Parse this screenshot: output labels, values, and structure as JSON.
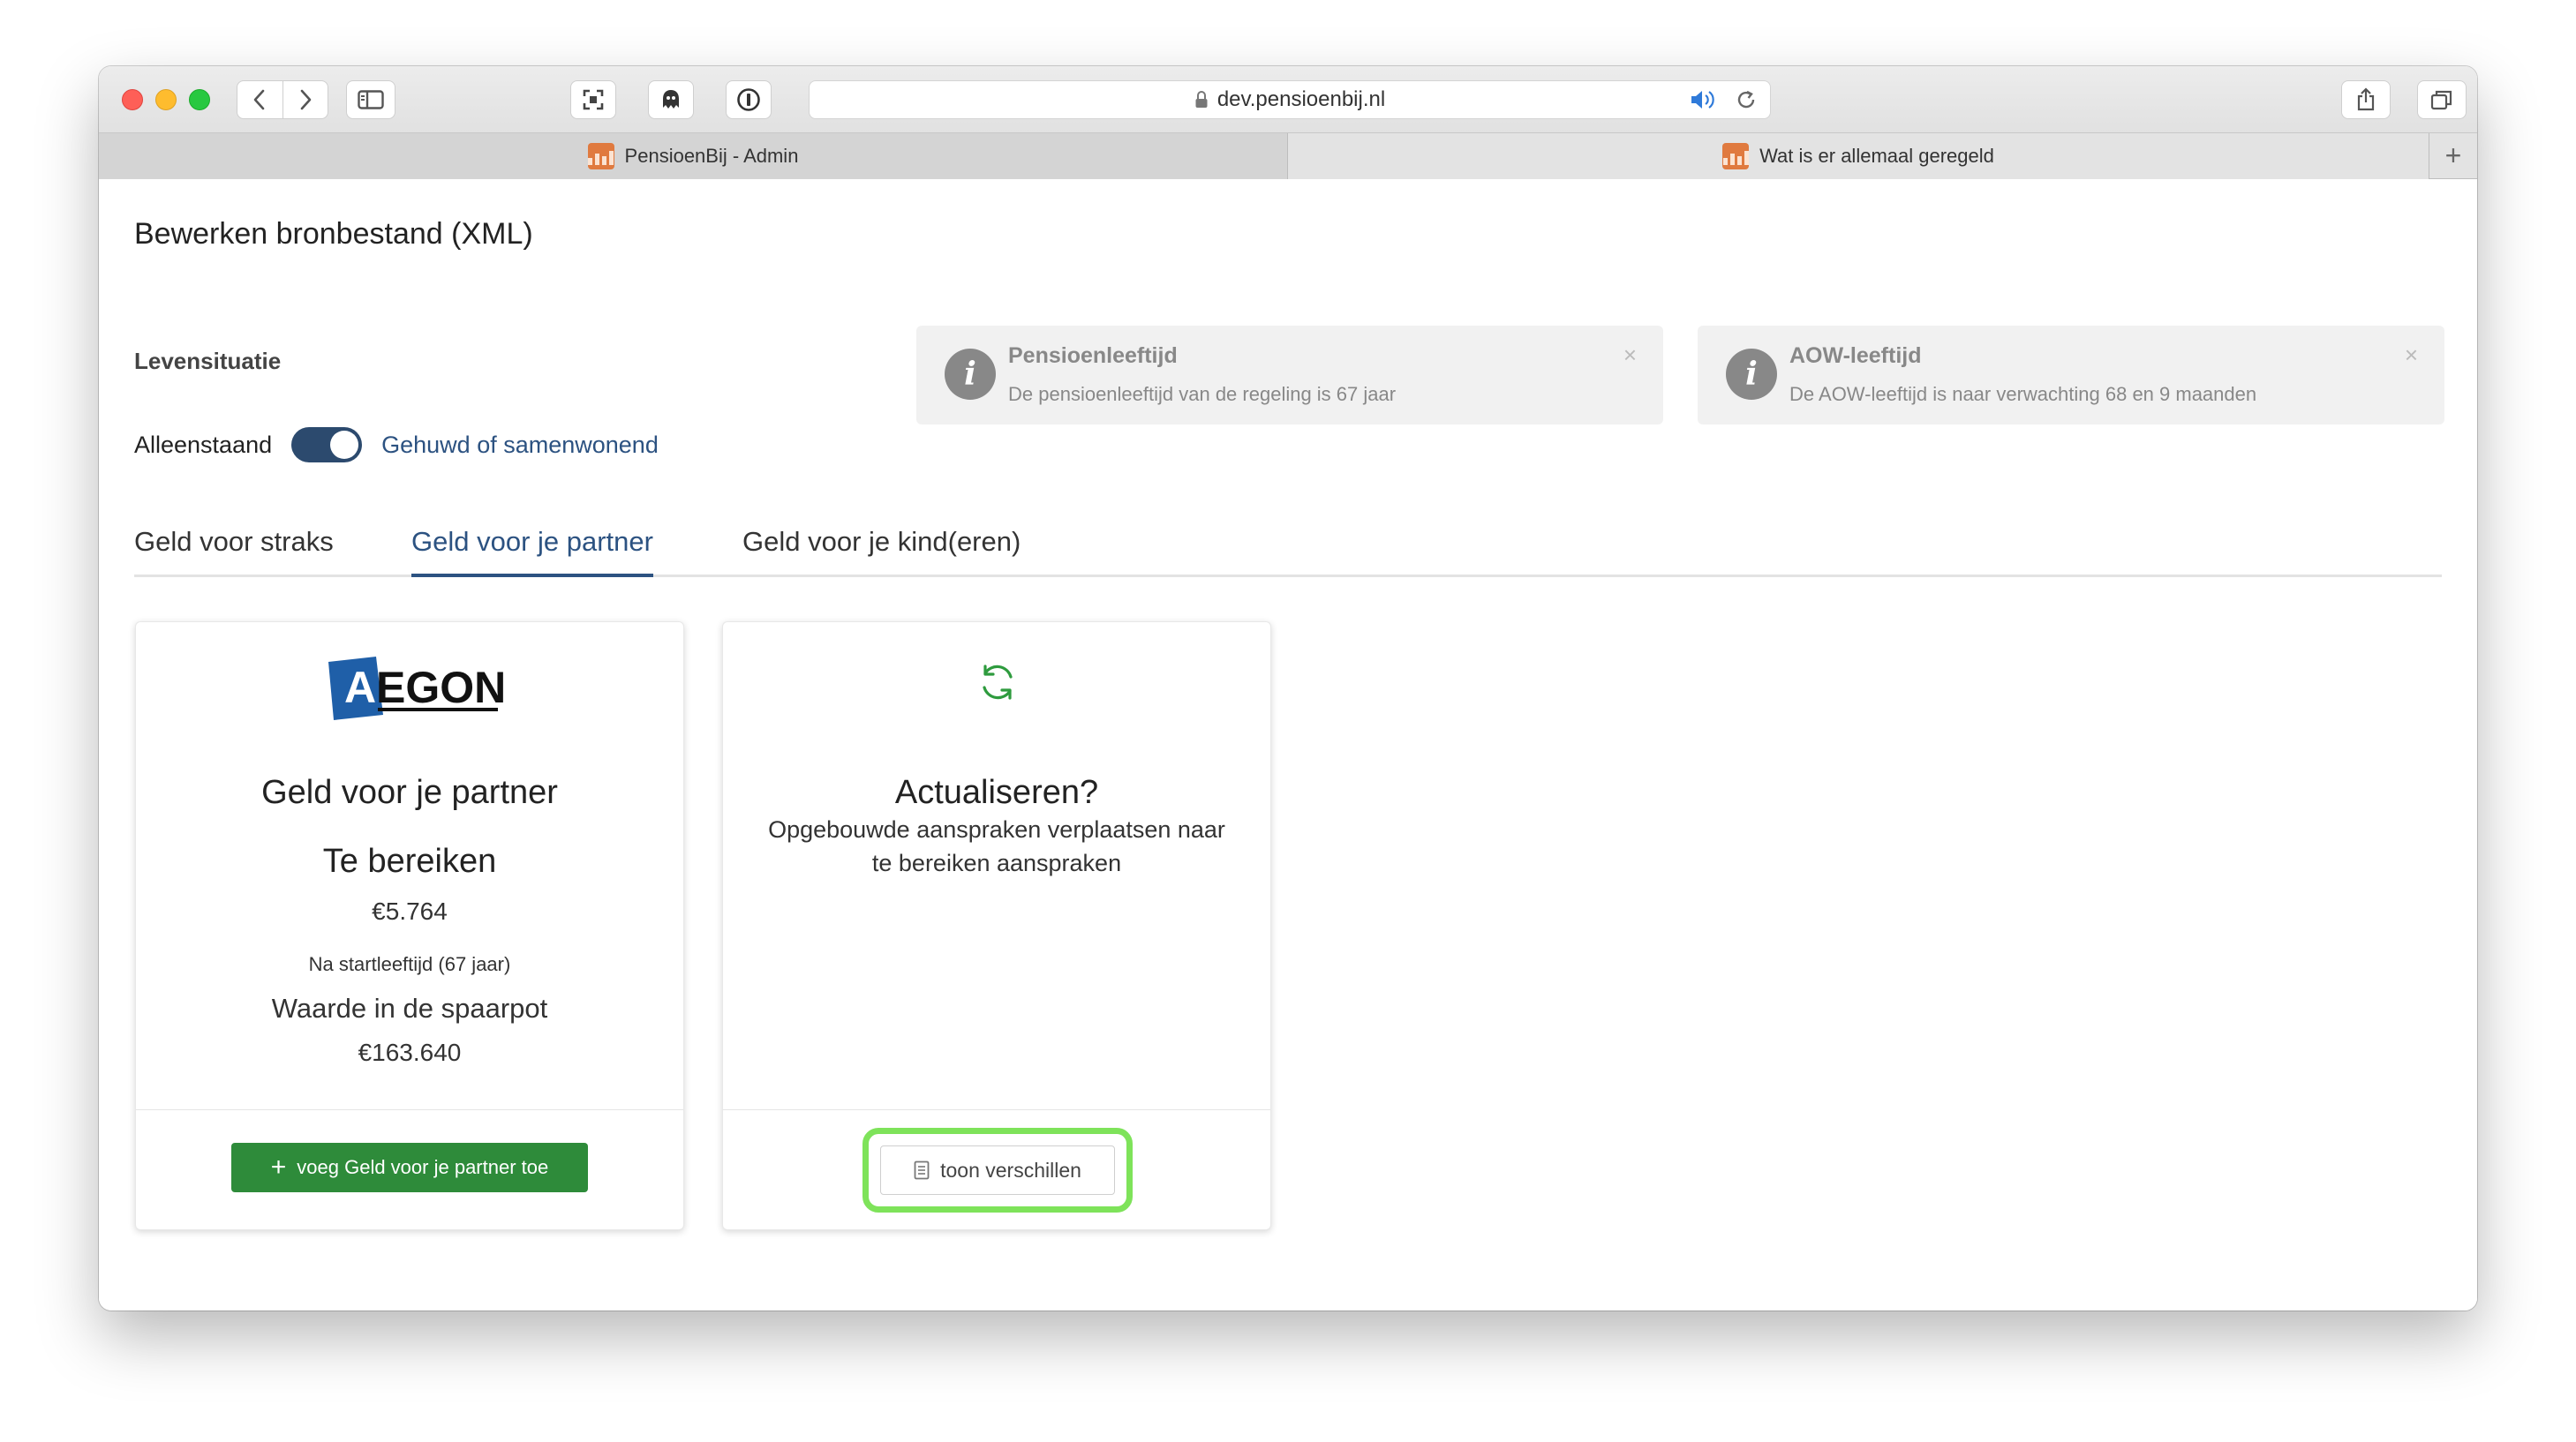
{
  "browser": {
    "url": "dev.pensioenbij.nl",
    "tabs": [
      {
        "label": "PensioenBij - Admin"
      },
      {
        "label": "Wat is er allemaal geregeld"
      }
    ],
    "new_tab": "+"
  },
  "page": {
    "title": "Bewerken bronbestand (XML)",
    "levensituatie": {
      "label": "Levensituatie",
      "option_off": "Alleenstaand",
      "option_on": "Gehuwd of samenwonend",
      "is_on": true
    },
    "alerts": [
      {
        "title": "Pensioenleeftijd",
        "text": "De pensioenleeftijd van de regeling is 67 jaar",
        "close": "×"
      },
      {
        "title": "AOW-leeftijd",
        "text": "De AOW-leeftijd is naar verwachting 68 en 9 maanden",
        "close": "×"
      }
    ],
    "tabs": [
      {
        "label": "Geld voor straks",
        "selected": false
      },
      {
        "label": "Geld voor je partner",
        "selected": true
      },
      {
        "label": "Geld voor je kind(eren)",
        "selected": false
      }
    ],
    "card_aegon": {
      "logo_text": "EGON",
      "logo_letter": "A",
      "heading": "Geld voor je partner",
      "target_label": "Te bereiken",
      "target_value": "€5.764",
      "start_note": "Na startleeftijd (67 jaar)",
      "savings_label": "Waarde in de spaarpot",
      "savings_value": "€163.640",
      "add_button": "voeg Geld voor je partner toe",
      "add_icon": "+"
    },
    "card_update": {
      "heading": "Actualiseren?",
      "description_line1": "Opgebouwde aanspraken verplaatsen naar",
      "description_line2": "te bereiken aanspraken",
      "diff_button": "toon verschillen"
    }
  },
  "colors": {
    "accent_blue": "#2c5281",
    "switch_bg": "#2c4a6e",
    "green_button": "#2e8b3a",
    "highlight_green": "#7ee35a",
    "refresh_icon": "#2e9b3e",
    "aegon_blue": "#1f5fa8"
  }
}
